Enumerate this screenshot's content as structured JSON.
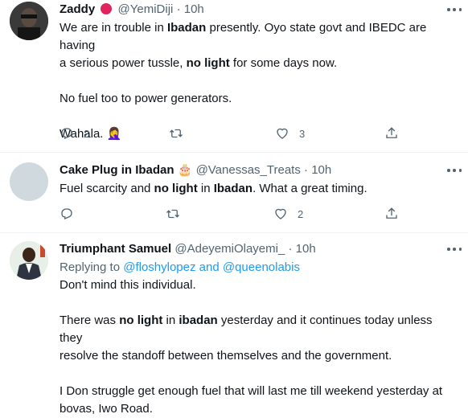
{
  "tweets": [
    {
      "name": "Zaddy",
      "handle": "@YemiDiji",
      "time": "10h",
      "lines": [
        [
          "We are in trouble in ",
          "Ibadan",
          " presently.  Oyo state govt and IBEDC are having"
        ],
        [
          "a serious power tussle,  ",
          "no light",
          " for some days now."
        ],
        "No fuel too to power generators.",
        "Wahala. 🤦‍♀️"
      ],
      "replies": "2",
      "retweets": "",
      "likes": "3"
    },
    {
      "name": "Cake Plug in Ibadan",
      "handle": "@Vanessas_Treats",
      "time": "10h",
      "text_parts": [
        "Fuel scarcity and ",
        "no light",
        " in ",
        "Ibadan",
        ". What a great timing."
      ],
      "replies": "",
      "retweets": "",
      "likes": "2"
    },
    {
      "name": "Triumphant Samuel",
      "handle": "@AdeyemiOlayemi_",
      "time": "10h",
      "replying_prefix": "Replying to ",
      "replying_to": "@floshylopez and @queenolabis",
      "line1": "Don't mind this individual.",
      "line2_parts": [
        "There was ",
        "no light",
        " in ",
        "ibadan",
        " yesterday and it continues today unless they"
      ],
      "line3": "resolve the standoff between themselves and the government.",
      "line4": "I Don struggle get enough fuel that will last me till weekend yesterday at",
      "line5": "bovas, Iwo Road."
    }
  ],
  "colors": {
    "muted": "#536471",
    "link": "#1d9bf0",
    "divider": "#eff3f4"
  },
  "icons": [
    "reply-icon",
    "retweet-icon",
    "like-icon",
    "share-icon",
    "more-icon",
    "verified-badge-icon"
  ]
}
